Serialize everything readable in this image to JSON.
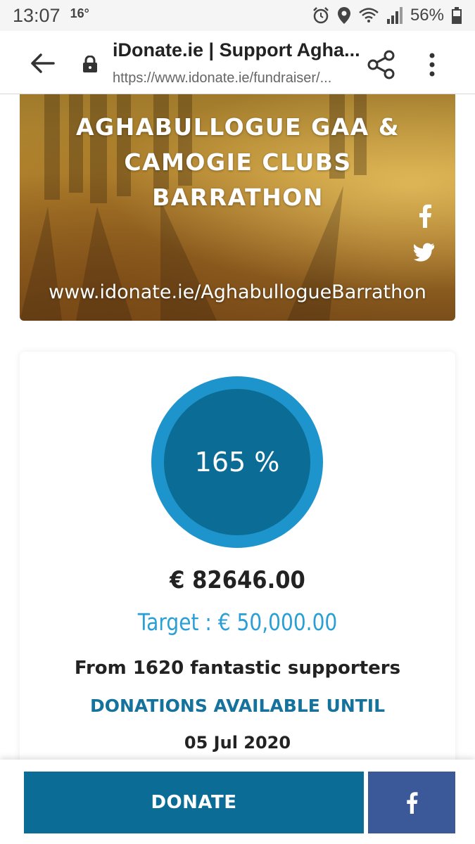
{
  "status_bar": {
    "time": "13:07",
    "temperature": "16°",
    "battery": "56%",
    "icons": [
      "alarm-icon",
      "location-icon",
      "wifi-icon",
      "signal-icon",
      "battery-icon"
    ]
  },
  "browser": {
    "page_title": "iDonate.ie | Support Agha...",
    "url": "https://www.idonate.ie/fundraiser/..."
  },
  "banner": {
    "title": "AGHABULLOGUE GAA & CAMOGIE CLUBS BARRATHON",
    "url": "www.idonate.ie/AghabullogueBarrathon",
    "social_icons": [
      "facebook-icon",
      "twitter-icon"
    ]
  },
  "progress": {
    "percent_label": "165 %",
    "percent_value": 165,
    "raised": "€ 82646.00",
    "target": "Target : € 50,000.00",
    "supporters": "From 1620 fantastic supporters",
    "until_label": "DONATIONS AVAILABLE UNTIL",
    "end_date": "05 Jul 2020"
  },
  "actions": {
    "donate_label": "DONATE",
    "share_icon": "facebook-icon"
  },
  "colors": {
    "primary": "#0b6d96",
    "ring_outer": "#1e94cc",
    "target_text": "#2a9fd6",
    "facebook": "#3b5998"
  }
}
